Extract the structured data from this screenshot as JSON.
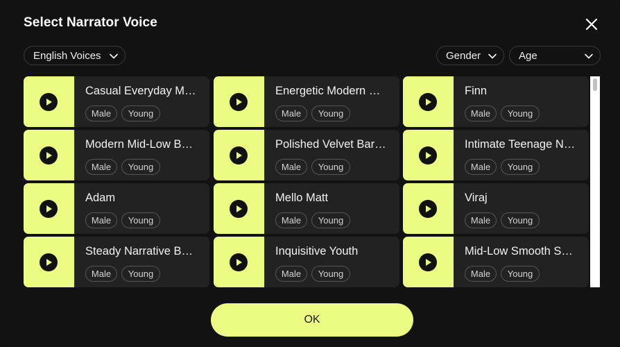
{
  "dialog": {
    "title": "Select Narrator Voice",
    "close_icon": "close-icon"
  },
  "filters": {
    "language": "English Voices",
    "gender": "Gender",
    "age": "Age"
  },
  "voices": [
    {
      "name": "Casual Everyday M…",
      "gender": "Male",
      "age": "Young"
    },
    {
      "name": "Energetic Modern …",
      "gender": "Male",
      "age": "Young"
    },
    {
      "name": "Finn",
      "gender": "Male",
      "age": "Young"
    },
    {
      "name": "Modern Mid-Low B…",
      "gender": "Male",
      "age": "Young"
    },
    {
      "name": "Polished Velvet Bar…",
      "gender": "Male",
      "age": "Young"
    },
    {
      "name": "Intimate Teenage N…",
      "gender": "Male",
      "age": "Young"
    },
    {
      "name": "Adam",
      "gender": "Male",
      "age": "Young"
    },
    {
      "name": "Mello Matt",
      "gender": "Male",
      "age": "Young"
    },
    {
      "name": "Viraj",
      "gender": "Male",
      "age": "Young"
    },
    {
      "name": "Steady Narrative B…",
      "gender": "Male",
      "age": "Young"
    },
    {
      "name": "Inquisitive Youth",
      "gender": "Male",
      "age": "Young"
    },
    {
      "name": "Mid-Low Smooth S…",
      "gender": "Male",
      "age": "Young"
    }
  ],
  "ok_label": "OK",
  "colors": {
    "accent": "#ecfc82",
    "background": "#121212",
    "card": "#222222"
  }
}
